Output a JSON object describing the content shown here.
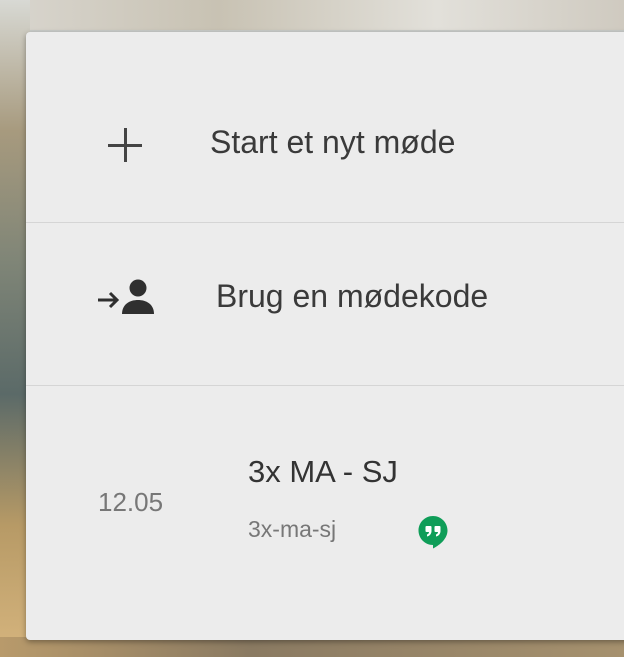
{
  "menu": {
    "start_meeting_label": "Start et nyt møde",
    "join_code_label": "Brug en mødekode"
  },
  "meeting": {
    "time": "12.05",
    "title": "3x MA - SJ",
    "code": "3x-ma-sj"
  },
  "icons": {
    "start": "plus-icon",
    "join": "join-person-arrow-icon",
    "chat": "hangouts-icon"
  },
  "colors": {
    "card_bg": "#ececec",
    "text_primary": "#3a3a3a",
    "text_secondary": "#777777",
    "hangouts_green": "#0f9d58",
    "icon_dark": "#2f2f2f"
  }
}
